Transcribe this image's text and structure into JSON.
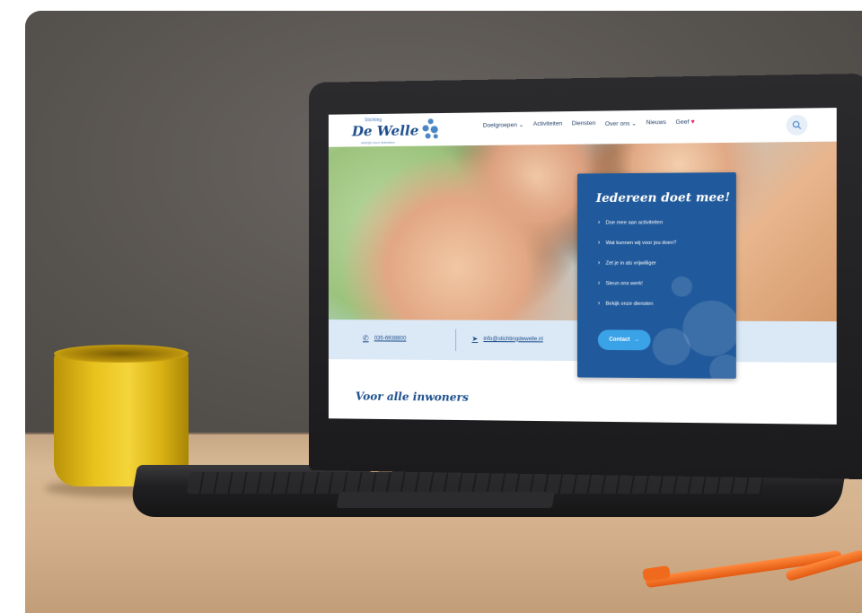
{
  "site": {
    "logo": {
      "small": "Stichting",
      "name": "De Welle",
      "sub": "welzijn voor iedereen"
    },
    "nav": [
      "Doelgroepen",
      "Activiteiten",
      "Diensten",
      "Over ons",
      "Nieuws",
      "Geef"
    ],
    "search_icon": "search-icon",
    "contact": {
      "phone": "035-6938800",
      "email": "info@stichtingdewelle.nl"
    },
    "card": {
      "title": "Iedereen doet mee!",
      "items": [
        "Doe mee aan activiteiten",
        "Wat kunnen wij voor jou doen?",
        "Zet je in als vrijwilliger",
        "Steun ons werk!",
        "Bekijk onze diensten"
      ],
      "button": "Contact"
    },
    "section_title": "Voor alle inwoners"
  },
  "colors": {
    "brand": "#1d4f8c",
    "card": "#215a9c",
    "accent": "#3aa2e6",
    "mug": "#f4d53a",
    "pen": "#f06a1e"
  }
}
